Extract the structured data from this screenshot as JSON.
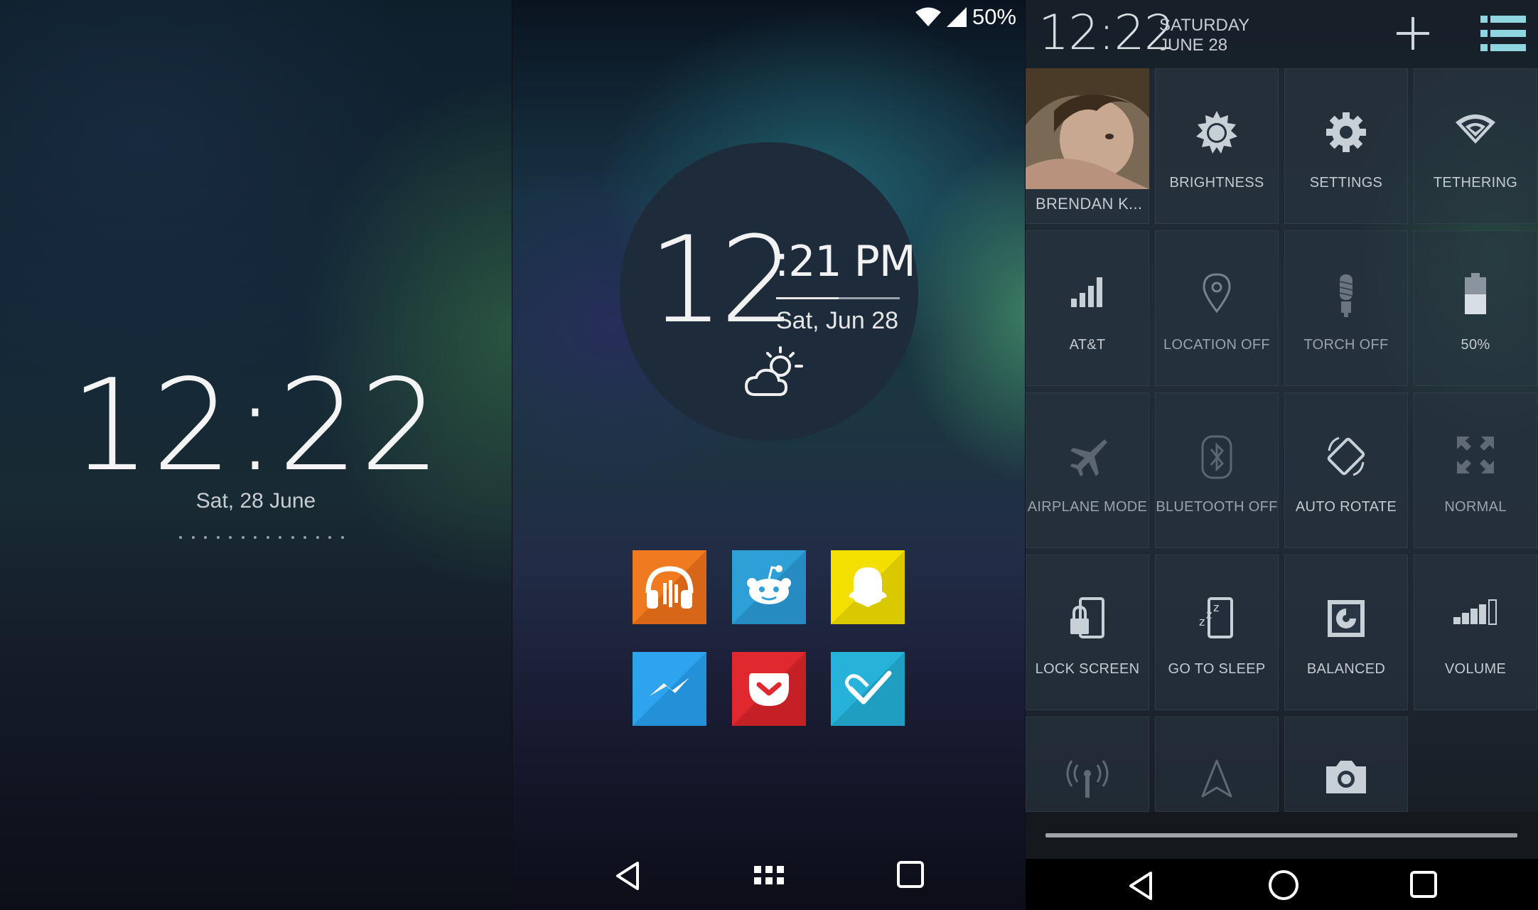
{
  "lock": {
    "time": "12:22",
    "date": "Sat, 28 June"
  },
  "home": {
    "status": {
      "battery": "50%"
    },
    "clock": {
      "hour": "12",
      "minutes_ampm": ":21 PM",
      "date": "Sat, Jun 28",
      "weather_icon": "partly-cloudy-icon"
    },
    "apps": [
      {
        "name": "Google Play Music",
        "icon": "headphones-icon",
        "color": "#f07a1f"
      },
      {
        "name": "Reddit",
        "icon": "reddit-alien-icon",
        "color": "#2f9fd8"
      },
      {
        "name": "Snapchat",
        "icon": "ghost-icon",
        "color": "#f3e000"
      },
      {
        "name": "Messenger",
        "icon": "messenger-icon",
        "color": "#2ea4ef"
      },
      {
        "name": "Pocket",
        "icon": "pocket-icon",
        "color": "#e0282f"
      },
      {
        "name": "Tasks",
        "icon": "checkmark-icon",
        "color": "#27b3d9"
      }
    ],
    "nav": [
      "back-icon",
      "app-drawer-icon",
      "recents-icon"
    ]
  },
  "qs": {
    "time": "12:22",
    "day": "SATURDAY",
    "date": "JUNE 28",
    "tiles": [
      {
        "label": "BRENDAN K..."
      },
      {
        "label": "BRIGHTNESS",
        "icon": "brightness-icon"
      },
      {
        "label": "SETTINGS",
        "icon": "gear-icon"
      },
      {
        "label": "TETHERING",
        "icon": "wifi-hotspot-icon"
      },
      {
        "label": "AT&T",
        "icon": "signal-icon"
      },
      {
        "label": "LOCATION OFF",
        "icon": "location-pin-icon"
      },
      {
        "label": "TORCH OFF",
        "icon": "bulb-icon"
      },
      {
        "label": "50%",
        "icon": "battery-icon"
      },
      {
        "label": "AIRPLANE MODE",
        "icon": "airplane-icon"
      },
      {
        "label": "BLUETOOTH OFF",
        "icon": "bluetooth-icon"
      },
      {
        "label": "AUTO ROTATE",
        "icon": "rotate-icon"
      },
      {
        "label": "NORMAL",
        "icon": "expand-icon"
      },
      {
        "label": "LOCK SCREEN",
        "icon": "lock-icon"
      },
      {
        "label": "GO TO SLEEP",
        "icon": "sleep-icon"
      },
      {
        "label": "BALANCED",
        "icon": "cpu-icon"
      },
      {
        "label": "VOLUME",
        "icon": "volume-bars-icon"
      }
    ],
    "extra_tiles": [
      "antenna-icon",
      "navigation-arrow-icon",
      "camera-icon"
    ]
  }
}
